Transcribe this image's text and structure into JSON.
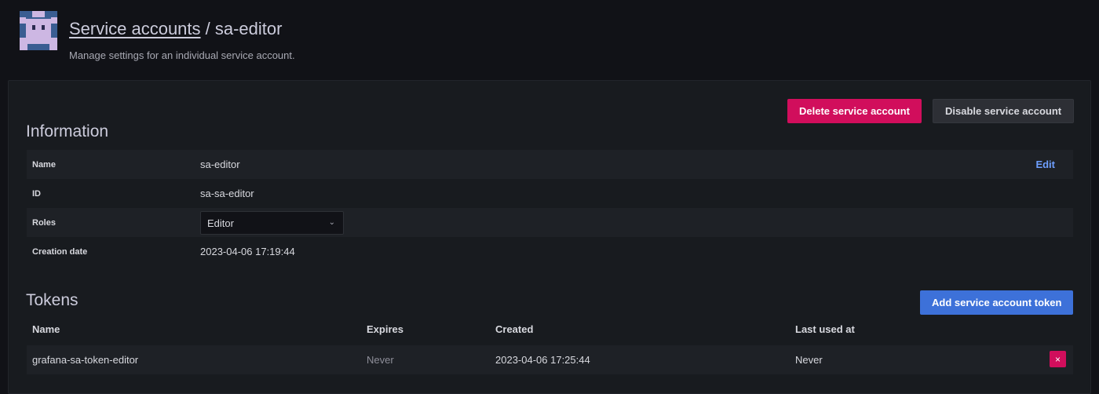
{
  "header": {
    "breadcrumb_link": "Service accounts",
    "separator": " / ",
    "current": "sa-editor",
    "subtitle": "Manage settings for an individual service account."
  },
  "actions": {
    "delete_label": "Delete service account",
    "disable_label": "Disable service account"
  },
  "information": {
    "heading": "Information",
    "rows": [
      {
        "label": "Name",
        "value": "sa-editor",
        "action": "Edit"
      },
      {
        "label": "ID",
        "value": "sa-sa-editor"
      },
      {
        "label": "Roles",
        "value": "Editor"
      },
      {
        "label": "Creation date",
        "value": "2023-04-06 17:19:44"
      }
    ]
  },
  "tokens": {
    "heading": "Tokens",
    "add_label": "Add service account token",
    "columns": [
      "Name",
      "Expires",
      "Created",
      "Last used at"
    ],
    "rows": [
      {
        "name": "grafana-sa-token-editor",
        "expires": "Never",
        "created": "2023-04-06 17:25:44",
        "last_used": "Never",
        "delete_icon": "×"
      }
    ]
  },
  "colors": {
    "background": "#111217",
    "panel": "#181b1f",
    "danger": "#d10e5c",
    "primary": "#3d71d9",
    "link": "#6e9fff"
  },
  "icons": {
    "avatar": "service-account-avatar-icon",
    "role_chevron": "chevron-down-icon",
    "token_delete": "close-icon"
  }
}
